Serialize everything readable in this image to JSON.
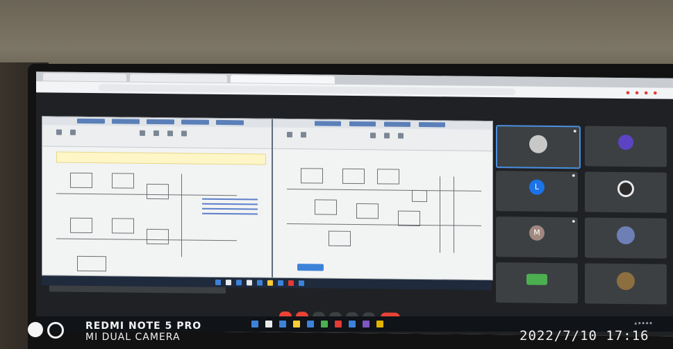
{
  "photo": {
    "description_tag": "photo-of-laptop-screen",
    "watermark": {
      "model": "REDMI NOTE 5 PRO",
      "camera": "MI DUAL CAMERA"
    },
    "timestamp": "2022/7/10  17:16"
  },
  "colors": {
    "meet_background": "#202124",
    "end_call": "#ea4335",
    "avatar_blue": "#1a73e8",
    "active_tile_border": "#4a90e2"
  }
}
